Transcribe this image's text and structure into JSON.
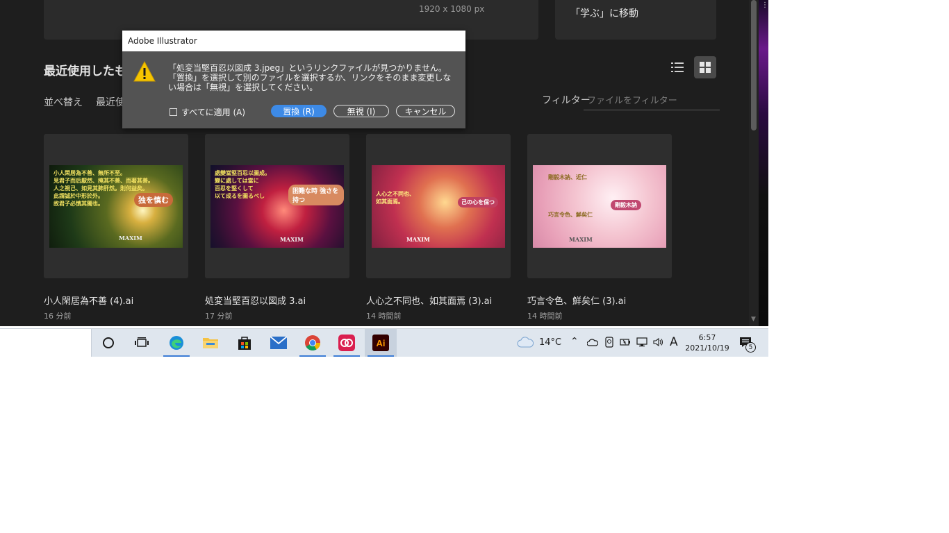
{
  "home": {
    "preset_size": "1920 x 1080 px",
    "learn_link": "「学ぶ」に移動",
    "section_title": "最近使用したも",
    "sort_label": "並べ替え",
    "sort_value": "最近使",
    "filter_label": "フィルター",
    "filter_placeholder": "ファイルをフィルター",
    "files": [
      {
        "name": "小人閑居為不善 (4).ai",
        "time": "16 分前",
        "thumb_lines": [
          "小人閑居為不善、無所不至。",
          "見君子而后厭然、掩其不善、而著其善。",
          "人之視己、如見其肺肝然。則何益矣。",
          "此謂誠於中形於外。",
          "故君子必慎其獨也。"
        ],
        "badge": "独を慎む",
        "maxim": "MAXIM"
      },
      {
        "name": "処変当堅百忍以図成 3.ai",
        "time": "17 分前",
        "thumb_lines": [
          "處變當堅百忍以圖成。",
          "變に處しては當に",
          "百忍を堅くして",
          "以て成るを圖るべし"
        ],
        "badge": "困難な時 強さを持つ",
        "maxim": "MAXIM"
      },
      {
        "name": "人心之不同也、如其面焉 (3).ai",
        "time": "14 時間前",
        "thumb_lines": [
          "人心之不同也、",
          "如其面焉。"
        ],
        "badge": "己の心を保つ",
        "maxim": "MAXIM"
      },
      {
        "name": "巧言令色、鮮矣仁 (3).ai",
        "time": "14 時間前",
        "thumb_lines": [
          "剛毅木訥、近仁",
          "巧言令色、鮮矣仁"
        ],
        "badge": "剛毅木訥",
        "maxim": "MAXIM"
      }
    ]
  },
  "dialog": {
    "title": "Adobe Illustrator",
    "message_lines": [
      "「処変当堅百忍以図成 3.jpeg」というリンクファイルが見つかりません。",
      "「置換」を選択して別のファイルを選択するか、リンクをそのまま変更しな",
      "い場合は「無視」を選択してください。"
    ],
    "apply_all_label": "すべてに適用 (A)",
    "replace_label": "置換 (R)",
    "ignore_label": "無視 (I)",
    "cancel_label": "キャンセル"
  },
  "taskbar": {
    "weather": "14°C",
    "ime": "A",
    "time": "6:57",
    "date": "2021/10/19",
    "notification_count": "5",
    "illustrator_label": "Ai",
    "accent": "#3a7bd5"
  }
}
